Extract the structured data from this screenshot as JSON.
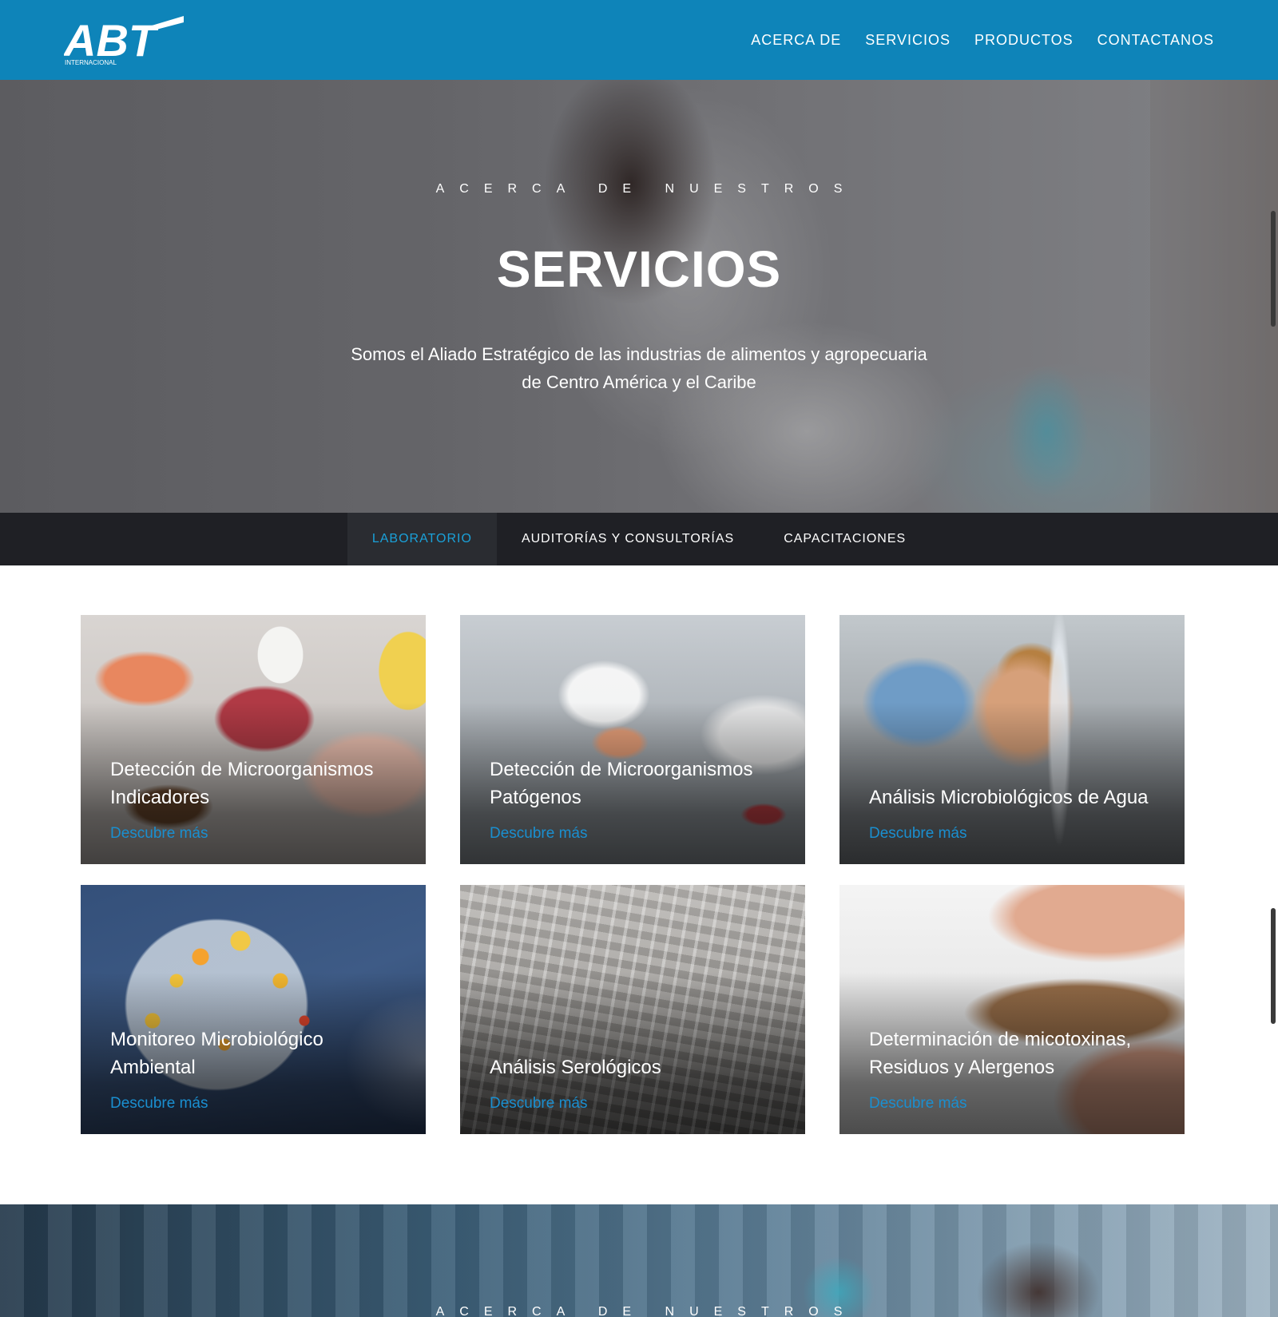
{
  "header": {
    "logo_text": "ABT",
    "logo_subtext": "INTERNACIONAL",
    "nav": [
      "ACERCA DE",
      "SERVICIOS",
      "PRODUCTOS",
      "CONTACTANOS"
    ],
    "colors": {
      "bar": "#0e84b9"
    }
  },
  "hero": {
    "kicker": "ACERCA DE NUESTROS",
    "title": "SERVICIOS",
    "subtitle_line1": "Somos el Aliado Estratégico de las industrias de alimentos y agropecuaria",
    "subtitle_line2": "de Centro América y el Caribe"
  },
  "tabs": {
    "items": [
      "LABORATORIO",
      "AUDITORÍAS Y CONSULTORÍAS",
      "CAPACITACIONES"
    ],
    "active": "LABORATORIO",
    "colors": {
      "bar": "#1f2025",
      "active_text": "#1aa1d9"
    }
  },
  "cards": [
    {
      "title": "Detección de Microorganismos Indicadores",
      "link": "Descubre más"
    },
    {
      "title": "Detección de Microorganismos Patógenos",
      "link": "Descubre más"
    },
    {
      "title": "Análisis Microbiológicos de Agua",
      "link": "Descubre más"
    },
    {
      "title": "Monitoreo Microbiológico Ambiental",
      "link": "Descubre más"
    },
    {
      "title": "Análisis Serológicos",
      "link": "Descubre más"
    },
    {
      "title": "Determinación de micotoxinas, Residuos y Alergenos",
      "link": "Descubre más"
    }
  ],
  "bottom_band": {
    "kicker": "ACERCA DE NUESTROS"
  }
}
